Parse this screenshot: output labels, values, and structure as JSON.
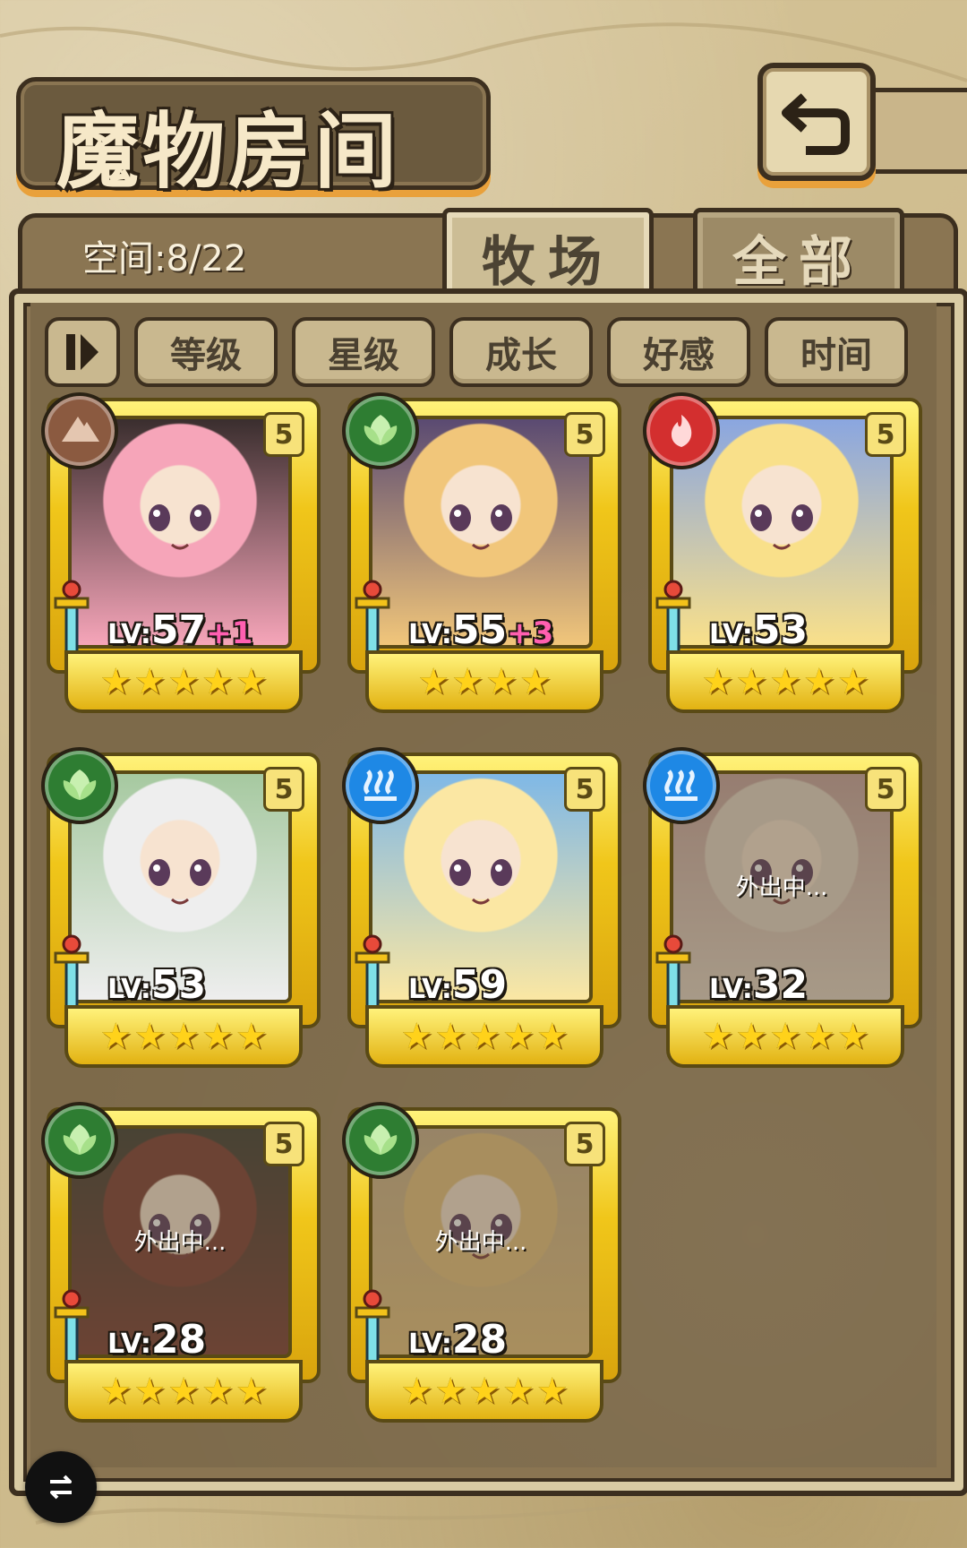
{
  "header": {
    "title": "魔物房间"
  },
  "panel": {
    "space_label": "空间:8/22"
  },
  "tabs": [
    {
      "label": "牧场",
      "active": true
    },
    {
      "label": "全部",
      "active": false
    }
  ],
  "sort_buttons": [
    {
      "label": "等级"
    },
    {
      "label": "星级"
    },
    {
      "label": "成长"
    },
    {
      "label": "好感"
    },
    {
      "label": "时间"
    }
  ],
  "colors": {
    "earth": "#8b5a40",
    "nature": "#2e7d32",
    "fire": "#d32f2f",
    "water": "#1e88e5",
    "gold": "#f0c61a"
  },
  "monsters": [
    {
      "element": "earth",
      "rarity": "5",
      "level_prefix": "LV:",
      "level": "57",
      "bonus": "+1",
      "stars": 5,
      "status": "",
      "palette": [
        "#f6a5b9",
        "#3a2e2e"
      ]
    },
    {
      "element": "nature",
      "rarity": "5",
      "level_prefix": "LV:",
      "level": "55",
      "bonus": "+3",
      "stars": 4,
      "status": "",
      "palette": [
        "#f1c67a",
        "#5a4a72"
      ]
    },
    {
      "element": "fire",
      "rarity": "5",
      "level_prefix": "LV:",
      "level": "53",
      "bonus": "",
      "stars": 5,
      "status": "",
      "palette": [
        "#f9e08a",
        "#8aa6e0"
      ]
    },
    {
      "element": "nature",
      "rarity": "5",
      "level_prefix": "LV:",
      "level": "53",
      "bonus": "",
      "stars": 5,
      "status": "",
      "palette": [
        "#eeeeee",
        "#a6c9a0"
      ]
    },
    {
      "element": "water",
      "rarity": "5",
      "level_prefix": "LV:",
      "level": "59",
      "bonus": "",
      "stars": 5,
      "status": "",
      "palette": [
        "#fbe7a3",
        "#7fb8e6"
      ]
    },
    {
      "element": "water",
      "rarity": "5",
      "level_prefix": "LV:",
      "level": "32",
      "bonus": "",
      "stars": 5,
      "status": "外出中...",
      "palette": [
        "#e6d7c6",
        "#c7a39c"
      ]
    },
    {
      "element": "nature",
      "rarity": "5",
      "level_prefix": "LV:",
      "level": "28",
      "bonus": "",
      "stars": 5,
      "status": "外出中...",
      "palette": [
        "#7a3a2e",
        "#3a3a2e"
      ]
    },
    {
      "element": "nature",
      "rarity": "5",
      "level_prefix": "LV:",
      "level": "28",
      "bonus": "",
      "stars": 5,
      "status": "外出中...",
      "palette": [
        "#e8c27a",
        "#c9b08a"
      ]
    }
  ]
}
